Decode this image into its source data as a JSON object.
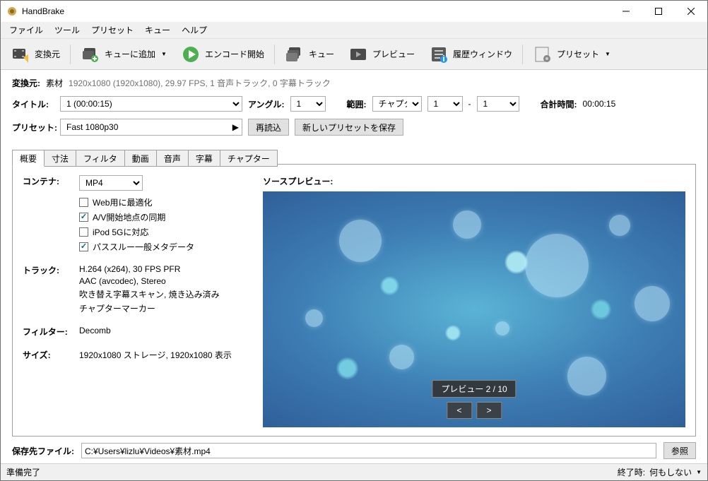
{
  "window": {
    "title": "HandBrake"
  },
  "menu": {
    "file": "ファイル",
    "tool": "ツール",
    "preset": "プリセット",
    "queue": "キュー",
    "help": "ヘルプ"
  },
  "toolbar": {
    "source": "変換元",
    "add_queue": "キューに追加",
    "start": "エンコード開始",
    "queue": "キュー",
    "preview": "プレビュー",
    "activity": "履歴ウィンドウ",
    "preset": "プリセット"
  },
  "source": {
    "label": "変換元:",
    "name": "素材",
    "info": "1920x1080 (1920x1080), 29.97 FPS, 1 音声トラック, 0 字幕トラック"
  },
  "title": {
    "label": "タイトル:",
    "value": "1 (00:00:15)",
    "angle_label": "アングル:",
    "angle": "1",
    "range_label": "範囲:",
    "range_type": "チャプター",
    "range_start": "1",
    "range_sep": "-",
    "range_end": "1",
    "duration_label": "合計時間:",
    "duration": "00:00:15"
  },
  "preset": {
    "label": "プリセット:",
    "value": "Fast 1080p30",
    "reload": "再読込",
    "save_new": "新しいプリセットを保存"
  },
  "tabs": {
    "summary": "概要",
    "dimensions": "寸法",
    "filter": "フィルタ",
    "video": "動画",
    "audio": "音声",
    "subtitle": "字幕",
    "chapter": "チャプター"
  },
  "summary": {
    "container_label": "コンテナ:",
    "container": "MP4",
    "web_opt": "Web用に最適化",
    "av_sync": "A/V開始地点の同期",
    "ipod": "iPod 5Gに対応",
    "passthru": "パススルー一般メタデータ",
    "track_label": "トラック:",
    "track0": "H.264 (x264), 30 FPS PFR",
    "track1": "AAC (avcodec), Stereo",
    "track2": "吹き替え字幕スキャン, 焼き込み済み",
    "track3": "チャプターマーカー",
    "filter_label": "フィルター:",
    "filter": "Decomb",
    "size_label": "サイズ:",
    "size": "1920x1080 ストレージ, 1920x1080 表示",
    "preview_label": "ソースプレビュー:",
    "preview_counter": "プレビュー 2 / 10"
  },
  "output": {
    "label": "保存先ファイル:",
    "path": "C:¥Users¥lizlu¥Videos¥素材.mp4",
    "browse": "参照"
  },
  "status": {
    "ready": "準備完了",
    "finish_label": "終了時:",
    "finish_action": "何もしない"
  }
}
